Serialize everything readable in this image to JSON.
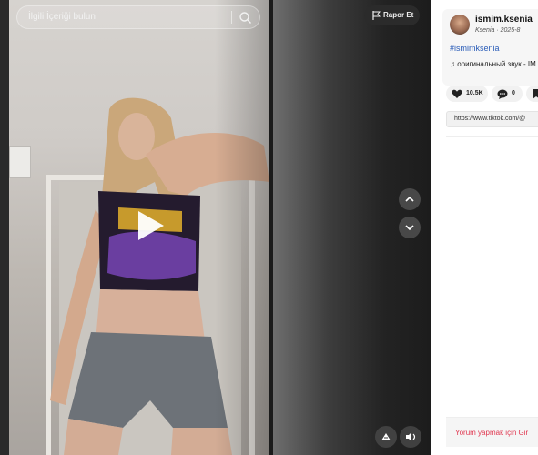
{
  "search": {
    "placeholder": "İlgili İçeriği bulun"
  },
  "report": {
    "label": "Rapor Et"
  },
  "video": {
    "play_icon": "play-icon"
  },
  "nav": {
    "up_icon": "chevron-up-icon",
    "down_icon": "chevron-down-icon"
  },
  "controls": {
    "pip_icon": "picture-in-picture-icon",
    "volume_icon": "volume-icon"
  },
  "author": {
    "username": "ismim.ksenia",
    "subline": "Ksenia · 2025-8"
  },
  "post": {
    "hashtag": "#ismimksenia",
    "music": "♫ оригинальный звук - IM"
  },
  "stats": {
    "likes": "10.5K",
    "comments": "0"
  },
  "share": {
    "url": "https://www.tiktok.com/@"
  },
  "comments": {
    "login_prompt": "Yorum yapmak için Gir"
  },
  "colors": {
    "accent": "#e0364f",
    "link": "#2b5db8"
  }
}
